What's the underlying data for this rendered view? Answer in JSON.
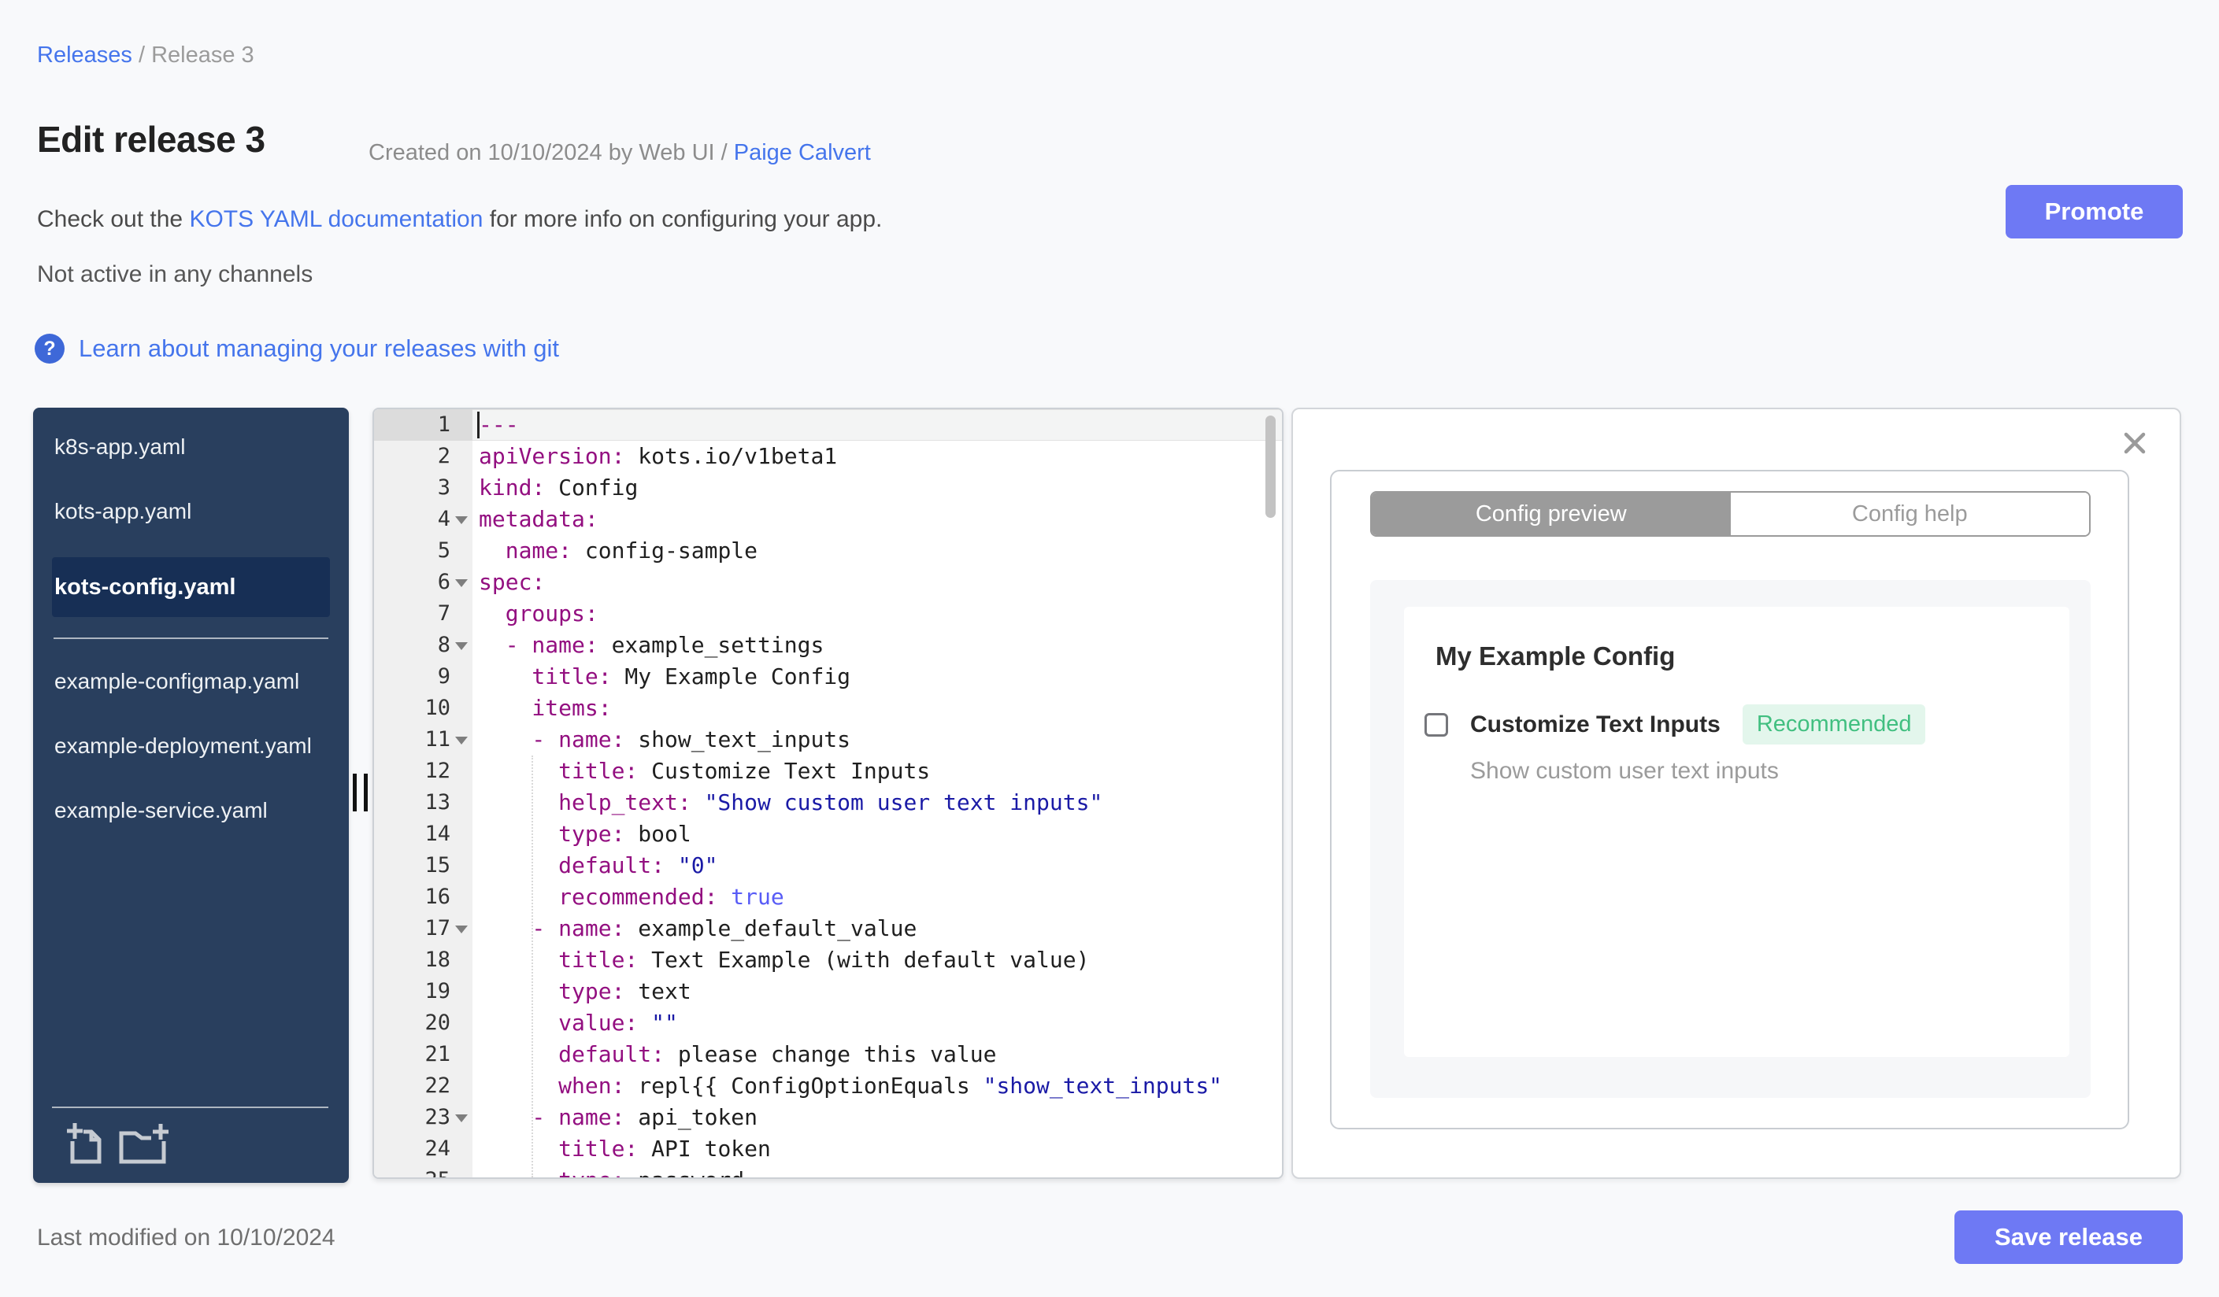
{
  "header": {
    "breadcrumb": {
      "link": "Releases",
      "separator": " / ",
      "current": "Release 3"
    },
    "title": "Edit release 3",
    "created_prefix": "Created on 10/10/2024 by Web UI / ",
    "created_author": "Paige Calvert",
    "docs": {
      "prefix": "Check out the ",
      "link": "KOTS YAML documentation",
      "suffix": " for more info on configuring your app."
    },
    "channel_status": "Not active in any channels",
    "help_icon_glyph": "?",
    "git_link": "Learn about managing your releases with git",
    "promote_label": "Promote"
  },
  "sidebar": {
    "sections": [
      {
        "files": [
          {
            "name": "k8s-app.yaml",
            "selected": false
          },
          {
            "name": "kots-app.yaml",
            "selected": false
          },
          {
            "name": "kots-config.yaml",
            "selected": true
          }
        ]
      },
      {
        "files": [
          {
            "name": "example-configmap.yaml",
            "selected": false
          },
          {
            "name": "example-deployment.yaml",
            "selected": false
          },
          {
            "name": "example-service.yaml",
            "selected": false
          }
        ]
      }
    ],
    "actions": [
      {
        "icon": "new-file-icon"
      },
      {
        "icon": "new-folder-icon"
      }
    ]
  },
  "editor": {
    "lines": [
      {
        "active": true,
        "fold": false,
        "tokens": [
          {
            "c": "key",
            "t": "---"
          }
        ]
      },
      {
        "fold": false,
        "tokens": [
          {
            "c": "key",
            "t": "apiVersion:"
          },
          {
            "c": "txt",
            "t": " kots.io/v1beta1"
          }
        ]
      },
      {
        "fold": false,
        "tokens": [
          {
            "c": "key",
            "t": "kind:"
          },
          {
            "c": "txt",
            "t": " Config"
          }
        ]
      },
      {
        "fold": true,
        "tokens": [
          {
            "c": "key",
            "t": "metadata:"
          }
        ]
      },
      {
        "fold": false,
        "tokens": [
          {
            "c": "key",
            "t": "  name:"
          },
          {
            "c": "txt",
            "t": " config-sample"
          }
        ]
      },
      {
        "fold": true,
        "tokens": [
          {
            "c": "key",
            "t": "spec:"
          }
        ]
      },
      {
        "fold": false,
        "tokens": [
          {
            "c": "key",
            "t": "  groups:"
          }
        ]
      },
      {
        "fold": true,
        "tokens": [
          {
            "c": "key",
            "t": "  - name:"
          },
          {
            "c": "txt",
            "t": " example_settings"
          }
        ]
      },
      {
        "fold": false,
        "tokens": [
          {
            "c": "key",
            "t": "    title:"
          },
          {
            "c": "txt",
            "t": " My Example Config"
          }
        ]
      },
      {
        "fold": false,
        "tokens": [
          {
            "c": "key",
            "t": "    items:"
          }
        ]
      },
      {
        "fold": true,
        "tokens": [
          {
            "c": "key",
            "t": "    - name:"
          },
          {
            "c": "txt",
            "t": " show_text_inputs"
          }
        ]
      },
      {
        "fold": false,
        "tokens": [
          {
            "c": "key",
            "t": "      title:"
          },
          {
            "c": "txt",
            "t": " Customize Text Inputs"
          }
        ]
      },
      {
        "fold": false,
        "tokens": [
          {
            "c": "key",
            "t": "      help_text:"
          },
          {
            "c": "str",
            "t": " \"Show custom user text inputs\""
          }
        ]
      },
      {
        "fold": false,
        "tokens": [
          {
            "c": "key",
            "t": "      type:"
          },
          {
            "c": "txt",
            "t": " bool"
          }
        ]
      },
      {
        "fold": false,
        "tokens": [
          {
            "c": "key",
            "t": "      default:"
          },
          {
            "c": "str",
            "t": " \"0\""
          }
        ]
      },
      {
        "fold": false,
        "tokens": [
          {
            "c": "key",
            "t": "      recommended:"
          },
          {
            "c": "bool",
            "t": " true"
          }
        ]
      },
      {
        "fold": true,
        "tokens": [
          {
            "c": "key",
            "t": "    - name:"
          },
          {
            "c": "txt",
            "t": " example_default_value"
          }
        ]
      },
      {
        "fold": false,
        "tokens": [
          {
            "c": "key",
            "t": "      title:"
          },
          {
            "c": "txt",
            "t": " Text Example (with default value)"
          }
        ]
      },
      {
        "fold": false,
        "tokens": [
          {
            "c": "key",
            "t": "      type:"
          },
          {
            "c": "txt",
            "t": " text"
          }
        ]
      },
      {
        "fold": false,
        "tokens": [
          {
            "c": "key",
            "t": "      value:"
          },
          {
            "c": "str",
            "t": " \"\""
          }
        ]
      },
      {
        "fold": false,
        "tokens": [
          {
            "c": "key",
            "t": "      default:"
          },
          {
            "c": "txt",
            "t": " please change this value"
          }
        ]
      },
      {
        "fold": false,
        "tokens": [
          {
            "c": "key",
            "t": "      when:"
          },
          {
            "c": "txt",
            "t": " repl{{ ConfigOptionEquals "
          },
          {
            "c": "str",
            "t": "\"show_text_inputs\""
          }
        ]
      },
      {
        "fold": true,
        "tokens": [
          {
            "c": "key",
            "t": "    - name:"
          },
          {
            "c": "txt",
            "t": " api_token"
          }
        ]
      },
      {
        "fold": false,
        "tokens": [
          {
            "c": "key",
            "t": "      title:"
          },
          {
            "c": "txt",
            "t": " API token"
          }
        ]
      },
      {
        "fold": false,
        "tokens": [
          {
            "c": "key",
            "t": "      type:"
          },
          {
            "c": "txt",
            "t": " password"
          }
        ]
      }
    ]
  },
  "config_panel": {
    "tabs": [
      {
        "label": "Config preview",
        "active": true
      },
      {
        "label": "Config help",
        "active": false
      }
    ],
    "group_title": "My Example Config",
    "item": {
      "label": "Customize Text Inputs",
      "badge": "Recommended",
      "help": "Show custom user text inputs",
      "checked": false
    }
  },
  "footer": {
    "last_modified": "Last modified on 10/10/2024",
    "save_label": "Save release"
  },
  "colors": {
    "accent_button": "#6e79f4",
    "link_blue": "#4575ec",
    "sidebar_bg": "#293f5e",
    "sidebar_selected_bg": "#172f55",
    "yaml_key": "#930f80",
    "yaml_string": "#1a1aa6",
    "yaml_bool": "#585cf6",
    "badge_bg": "#e3f6ec",
    "badge_text": "#41bf80",
    "tab_active_bg": "#9b9b9b"
  }
}
